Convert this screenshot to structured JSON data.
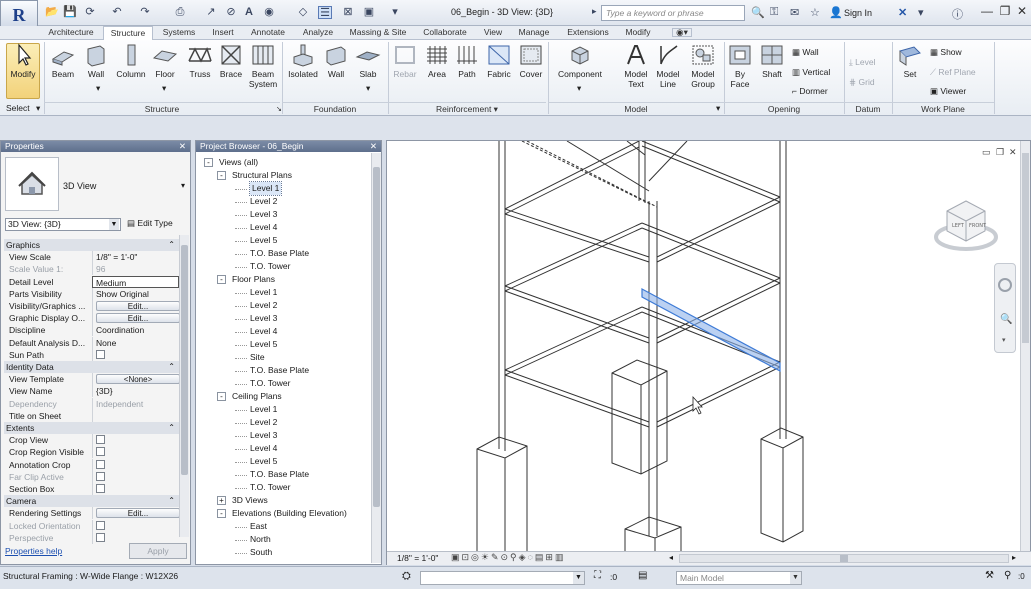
{
  "window": {
    "title": "06_Begin - 3D View: {3D}",
    "search_placeholder": "Type a keyword or phrase",
    "sign_in": "Sign In",
    "app_letter": "R"
  },
  "tabs": [
    "Architecture",
    "Structure",
    "Systems",
    "Insert",
    "Annotate",
    "Analyze",
    "Massing & Site",
    "Collaborate",
    "View",
    "Manage",
    "Extensions",
    "Modify"
  ],
  "active_tab": "Structure",
  "ribbon": {
    "modify": "Modify",
    "select": "Select",
    "structure": {
      "beam": "Beam",
      "wall": "Wall",
      "column": "Column",
      "floor": "Floor",
      "truss": "Truss",
      "brace": "Brace",
      "beam_system_1": "Beam",
      "beam_system_2": "System",
      "label": "Structure"
    },
    "foundation": {
      "isolated": "Isolated",
      "wall": "Wall",
      "slab": "Slab",
      "label": "Foundation"
    },
    "reinforcement": {
      "rebar": "Rebar",
      "area": "Area",
      "path": "Path",
      "fabric": "Fabric",
      "cover": "Cover",
      "label": "Reinforcement"
    },
    "model": {
      "component": "Component",
      "model_text_1": "Model",
      "model_text_2": "Text",
      "model_line_1": "Model",
      "model_line_2": "Line",
      "model_group_1": "Model",
      "model_group_2": "Group",
      "label": "Model"
    },
    "opening": {
      "by_face_1": "By",
      "by_face_2": "Face",
      "shaft": "Shaft",
      "wall": "Wall",
      "vertical": "Vertical",
      "dormer": "Dormer",
      "label": "Opening"
    },
    "datum": {
      "level": "Level",
      "grid": "Grid",
      "label": "Datum"
    },
    "work_plane": {
      "set": "Set",
      "show": "Show",
      "ref_plane": "Ref Plane",
      "viewer": "Viewer",
      "label": "Work Plane"
    }
  },
  "properties": {
    "header": "Properties",
    "type_name": "3D View",
    "instance_selector": "3D View: {3D}",
    "edit_type": "Edit Type",
    "rows": [
      {
        "k": "Graphics",
        "grp": true
      },
      {
        "k": "View Scale",
        "v": "1/8\" = 1'-0\""
      },
      {
        "k": "Scale Value    1:",
        "v": "96",
        "dis": true
      },
      {
        "k": "Detail Level",
        "v": "Medium",
        "box": true
      },
      {
        "k": "Parts Visibility",
        "v": "Show Original"
      },
      {
        "k": "Visibility/Graphics ...",
        "btn": "Edit..."
      },
      {
        "k": "Graphic Display O...",
        "btn": "Edit..."
      },
      {
        "k": "Discipline",
        "v": "Coordination"
      },
      {
        "k": "Default Analysis D...",
        "v": "None"
      },
      {
        "k": "Sun Path",
        "chk": true
      },
      {
        "k": "Identity Data",
        "grp": true
      },
      {
        "k": "View Template",
        "btn": "<None>"
      },
      {
        "k": "View Name",
        "v": "{3D}"
      },
      {
        "k": "Dependency",
        "v": "Independent",
        "dis": true
      },
      {
        "k": "Title on Sheet",
        "v": ""
      },
      {
        "k": "Extents",
        "grp": true
      },
      {
        "k": "Crop View",
        "chk": true
      },
      {
        "k": "Crop Region Visible",
        "chk": true
      },
      {
        "k": "Annotation Crop",
        "chk": true
      },
      {
        "k": "Far Clip Active",
        "chk": true,
        "dis": true
      },
      {
        "k": "Section Box",
        "chk": true
      },
      {
        "k": "Camera",
        "grp": true
      },
      {
        "k": "Rendering Settings",
        "btn": "Edit..."
      },
      {
        "k": "Locked Orientation",
        "chk": true,
        "dis": true
      },
      {
        "k": "Perspective",
        "chk": true,
        "dis": true
      }
    ],
    "help": "Properties help",
    "apply": "Apply"
  },
  "browser": {
    "header": "Project Browser - 06_Begin",
    "items": [
      {
        "t": "Views (all)",
        "lvl": 0,
        "exp": "-"
      },
      {
        "t": "Structural Plans",
        "lvl": 1,
        "exp": "-"
      },
      {
        "t": "Level 1",
        "lvl": 2,
        "sel": true
      },
      {
        "t": "Level 2",
        "lvl": 2
      },
      {
        "t": "Level 3",
        "lvl": 2
      },
      {
        "t": "Level 4",
        "lvl": 2
      },
      {
        "t": "Level 5",
        "lvl": 2
      },
      {
        "t": "T.O. Base Plate",
        "lvl": 2
      },
      {
        "t": "T.O. Tower",
        "lvl": 2
      },
      {
        "t": "Floor Plans",
        "lvl": 1,
        "exp": "-"
      },
      {
        "t": "Level 1",
        "lvl": 2
      },
      {
        "t": "Level 2",
        "lvl": 2
      },
      {
        "t": "Level 3",
        "lvl": 2
      },
      {
        "t": "Level 4",
        "lvl": 2
      },
      {
        "t": "Level 5",
        "lvl": 2
      },
      {
        "t": "Site",
        "lvl": 2
      },
      {
        "t": "T.O. Base Plate",
        "lvl": 2
      },
      {
        "t": "T.O. Tower",
        "lvl": 2
      },
      {
        "t": "Ceiling Plans",
        "lvl": 1,
        "exp": "-"
      },
      {
        "t": "Level 1",
        "lvl": 2
      },
      {
        "t": "Level 2",
        "lvl": 2
      },
      {
        "t": "Level 3",
        "lvl": 2
      },
      {
        "t": "Level 4",
        "lvl": 2
      },
      {
        "t": "Level 5",
        "lvl": 2
      },
      {
        "t": "T.O. Base Plate",
        "lvl": 2
      },
      {
        "t": "T.O. Tower",
        "lvl": 2
      },
      {
        "t": "3D Views",
        "lvl": 1,
        "exp": "+"
      },
      {
        "t": "Elevations (Building Elevation)",
        "lvl": 1,
        "exp": "-"
      },
      {
        "t": "East",
        "lvl": 2
      },
      {
        "t": "North",
        "lvl": 2
      },
      {
        "t": "South",
        "lvl": 2
      }
    ]
  },
  "viewport": {
    "scale": "1/8\" = 1'-0\"",
    "viewcube_labels": {
      "left": "LEFT",
      "front": "FRONT"
    }
  },
  "statusbar": {
    "message": "Structural Framing : W-Wide Flange : W12X26",
    "count": ":0",
    "model": "Main Model"
  },
  "colors": {
    "highlight": "#3e7bd6",
    "selection": "#dbe7f7",
    "panel_header": "#6a7a96"
  }
}
